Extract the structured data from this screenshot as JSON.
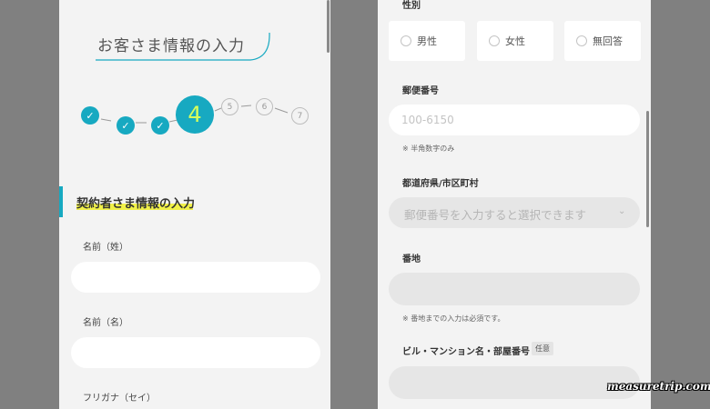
{
  "left": {
    "title": "お客さま情報の入力",
    "steps": {
      "done_icon": "check-icon",
      "done_mark": "✓",
      "current": "4",
      "upcoming": [
        "5",
        "6",
        "7"
      ]
    },
    "section_title": "契約者さま情報の入力",
    "fields": [
      {
        "label": "名前（姓）",
        "value": ""
      },
      {
        "label": "名前（名）",
        "value": ""
      },
      {
        "label": "フリガナ（セイ）"
      }
    ]
  },
  "right": {
    "gender": {
      "label": "性別",
      "options": [
        "男性",
        "女性",
        "無回答"
      ]
    },
    "postal": {
      "label": "郵便番号",
      "placeholder": "100-6150",
      "note": "※ 半角数字のみ"
    },
    "prefecture": {
      "label": "都道府県/市区町村",
      "value": "郵便番号を入力すると選択できます"
    },
    "address": {
      "label": "番地",
      "note": "※ 番地までの入力は必須です。"
    },
    "building": {
      "label": "ビル・マンション名・部屋番号",
      "badge": "任意"
    }
  },
  "watermark": "measuretrip.com",
  "colors": {
    "accent": "#17a9c1",
    "highlight": "#f0f02a",
    "current_step_text": "#d7ff5a"
  }
}
